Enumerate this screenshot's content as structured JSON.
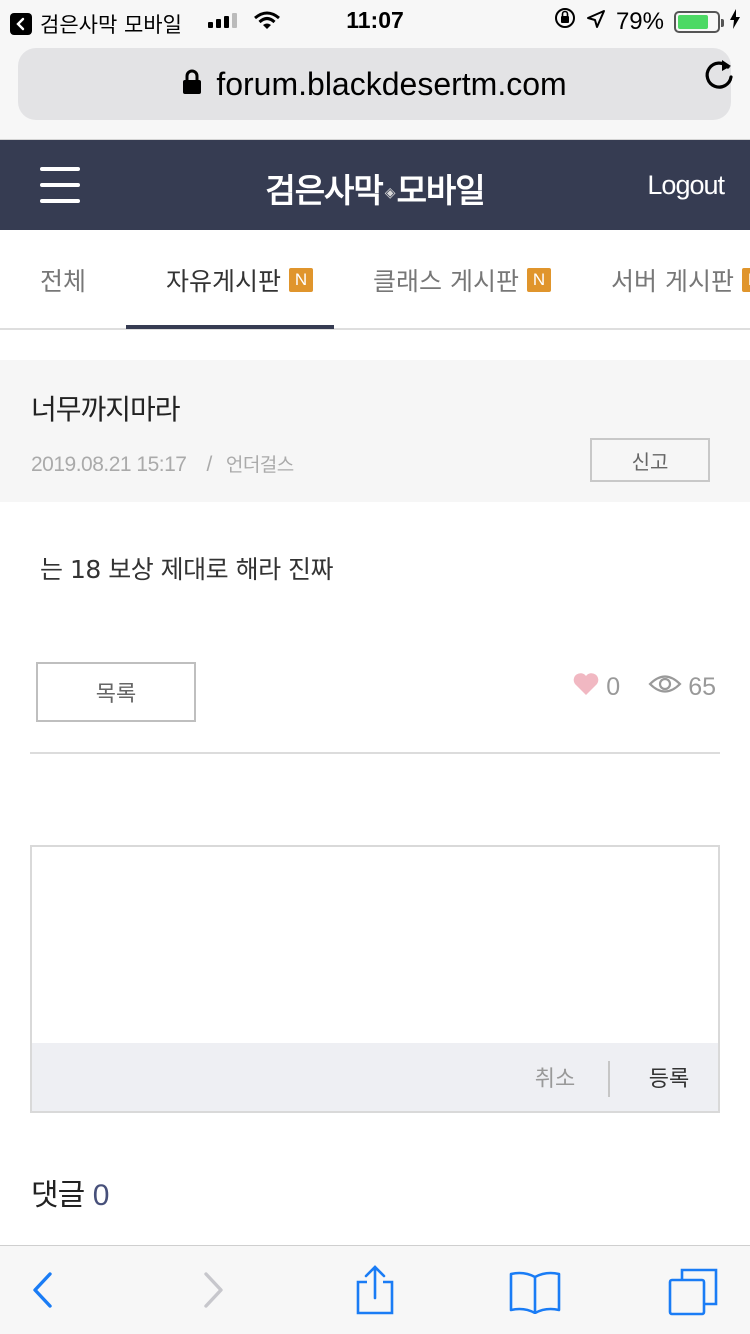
{
  "status_bar": {
    "back_app": "검은사막 모바일",
    "time": "11:07",
    "battery": "79%",
    "battery_level": 0.79
  },
  "browser": {
    "url": "forum.blackdesertm.com"
  },
  "header": {
    "logo_left": "검은사막",
    "logo_right": "모바일",
    "logout": "Logout"
  },
  "tabs": [
    {
      "label": "전체",
      "badge": ""
    },
    {
      "label": "자유게시판",
      "badge": "N"
    },
    {
      "label": "클래스 게시판",
      "badge": "N"
    },
    {
      "label": "서버 게시판",
      "badge": "N"
    }
  ],
  "post": {
    "title": "너무까지마라",
    "date": "2019.08.21 15:17",
    "separator": "/",
    "author": "언더걸스",
    "report_label": "신고",
    "body": "는 18 보상 제대로 해라 진짜",
    "list_label": "목록",
    "likes": "0",
    "views": "65"
  },
  "comment_form": {
    "cancel_label": "취소",
    "submit_label": "등록"
  },
  "comments": {
    "heading": "댓글",
    "count": "0"
  },
  "colors": {
    "header_bg": "#363c52",
    "badge": "#e0952c",
    "ios_blue": "#1a7cf5",
    "heart": "#f1b8c2"
  }
}
